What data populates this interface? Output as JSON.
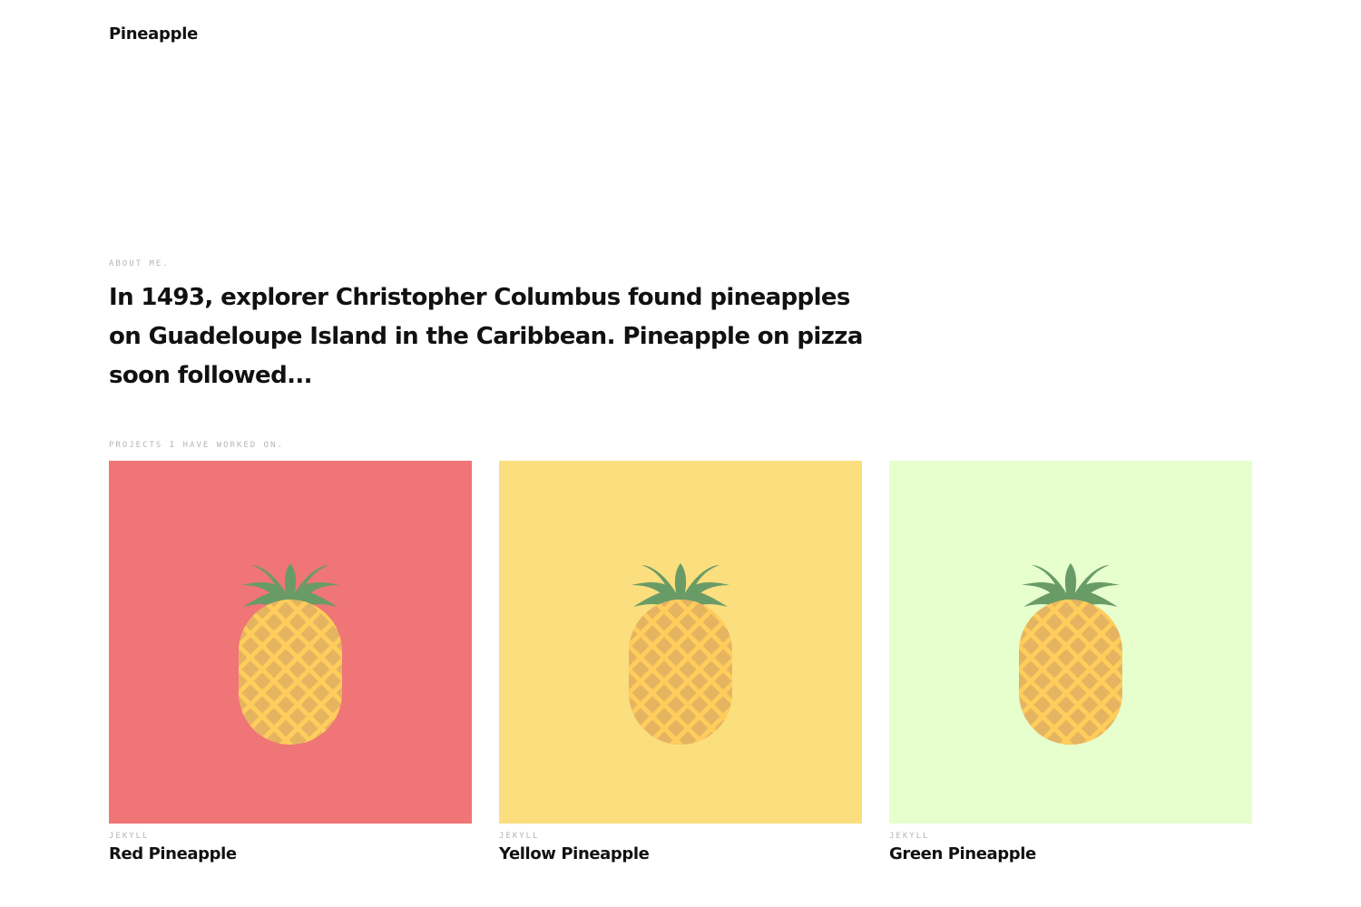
{
  "header": {
    "site_title": "Pineapple"
  },
  "about": {
    "label": "About me.",
    "text": "In 1493, explorer Christopher Columbus found pineapples on Guadeloupe Island in the Caribbean. Pineapple on pizza soon followed..."
  },
  "projects": {
    "label": "Projects I have worked on.",
    "items": [
      {
        "tag": "Jekyll",
        "title": "Red Pineapple",
        "bg_color": "#f07576",
        "icon": "pineapple-icon"
      },
      {
        "tag": "Jekyll",
        "title": "Yellow Pineapple",
        "bg_color": "#fbdf7e",
        "icon": "pineapple-icon"
      },
      {
        "tag": "Jekyll",
        "title": "Green Pineapple",
        "bg_color": "#e6ffcc",
        "icon": "pineapple-icon"
      }
    ]
  },
  "colors": {
    "leaf": "#699b67",
    "fruit": "#e5b460",
    "fruit_lines": "#ffcd5c"
  }
}
